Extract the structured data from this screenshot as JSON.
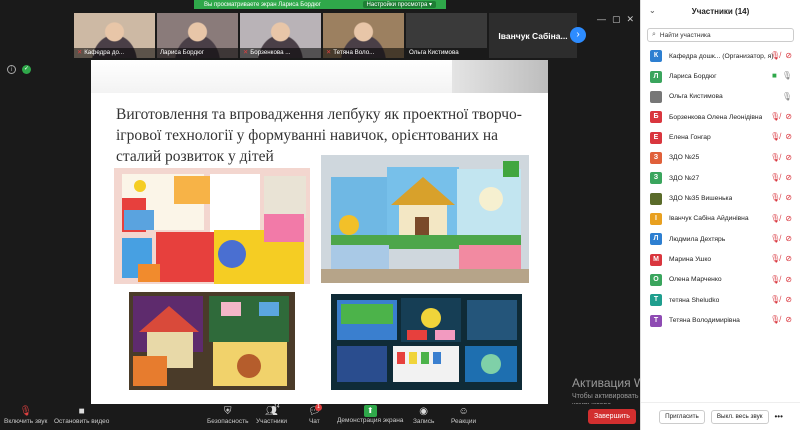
{
  "share_bar": {
    "text": "Вы просматриваете экран Лариса Бордюг",
    "settings": "Настройки просмотра ▾"
  },
  "thumbnails": [
    {
      "name": "Кафедра до...",
      "muted": true,
      "bg": "#cdb9a4"
    },
    {
      "name": "Лариса Бордюг",
      "muted": false,
      "bg": "#8a7b7a"
    },
    {
      "name": "Борзенкова ...",
      "muted": true,
      "bg": "#b9b3b7"
    },
    {
      "name": "Тетяна Воло...",
      "muted": true,
      "bg": "#9c8060"
    },
    {
      "name": "Ольга Кистимова",
      "muted": false,
      "bg": "#3a3a3a"
    }
  ],
  "name_tile": "Іванчук Сабіна...",
  "slide": {
    "title_lines": [
      "Виготовлення та впровадження лепбуку як проектної творчо-",
      "ігрової технології у формуванні навичок, орієнтованих на",
      "сталий розвиток у дітей"
    ]
  },
  "watermark": {
    "title": "Активация Windows",
    "subtitle": "Чтобы активировать Windows, перейдите к параметрам компьютера."
  },
  "toolbar": {
    "audio": "Включить звук",
    "video": "Остановить видео",
    "security": "Безопасность",
    "participants": "Участники",
    "participants_count": "14",
    "chat": "Чат",
    "chat_badge": "1",
    "share": "Демонстрация экрана",
    "record": "Запись",
    "reactions": "Реакции",
    "end": "Завершить"
  },
  "panel": {
    "title": "Участники (14)",
    "search_placeholder": "Найти участника",
    "participants": [
      {
        "initial": "К",
        "name": "Кафедра дошк... (Организатор, я)",
        "color": "#2d7fd1",
        "mic": "off",
        "video": "off"
      },
      {
        "initial": "Л",
        "name": "Лариса Бордюг",
        "color": "#3aa55d",
        "mic": "on",
        "video": "on"
      },
      {
        "initial": "",
        "name": "Ольга Кистимова",
        "color": "#777777",
        "mic": "on",
        "video": "none"
      },
      {
        "initial": "Б",
        "name": "Борзенкова Олена Леонідівна",
        "color": "#d9363e",
        "mic": "off",
        "video": "off"
      },
      {
        "initial": "Е",
        "name": "Елена Гонгар",
        "color": "#d9363e",
        "mic": "off",
        "video": "off"
      },
      {
        "initial": "З",
        "name": "ЗДО №25",
        "color": "#e0603a",
        "mic": "off",
        "video": "off"
      },
      {
        "initial": "З",
        "name": "ЗДО №27",
        "color": "#3aa55d",
        "mic": "off",
        "video": "off"
      },
      {
        "initial": "",
        "name": "ЗДО №35 Вишенька",
        "color": "#5a6b2a",
        "mic": "off",
        "video": "off"
      },
      {
        "initial": "І",
        "name": "Іванчук Сабіна Айдинівна",
        "color": "#e8a020",
        "mic": "off",
        "video": "off"
      },
      {
        "initial": "Л",
        "name": "Людмила Дехтярь",
        "color": "#2d7fd1",
        "mic": "off",
        "video": "off"
      },
      {
        "initial": "М",
        "name": "Марина Ушко",
        "color": "#d9363e",
        "mic": "off",
        "video": "off"
      },
      {
        "initial": "О",
        "name": "Олена Марченко",
        "color": "#3aa55d",
        "mic": "off",
        "video": "off"
      },
      {
        "initial": "Т",
        "name": "тетяна Sheludko",
        "color": "#1f9e8e",
        "mic": "off",
        "video": "off"
      },
      {
        "initial": "Т",
        "name": "Тетяна Володимирівна",
        "color": "#8e4bb3",
        "mic": "off",
        "video": "off"
      }
    ],
    "invite": "Пригласить",
    "mute_all": "Выкл. весь звук",
    "more": "•••"
  }
}
